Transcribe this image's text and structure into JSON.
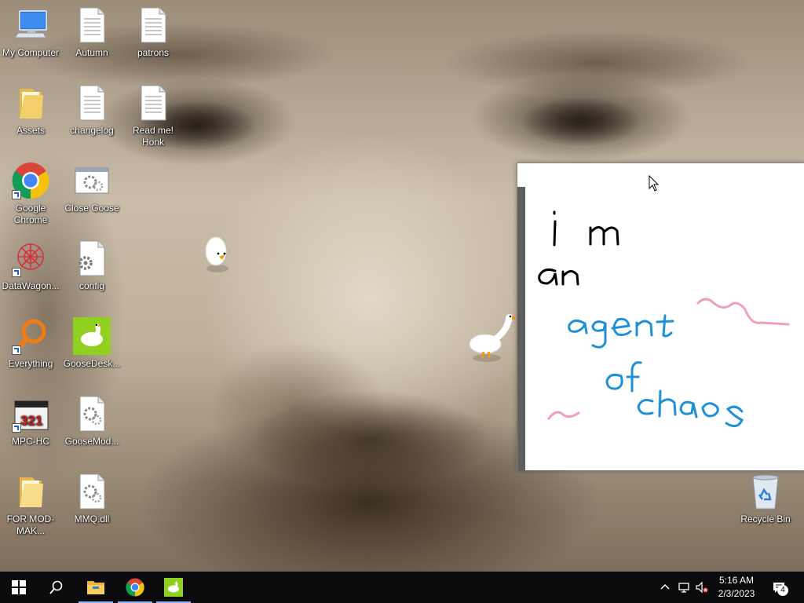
{
  "desktop": {
    "icons": [
      {
        "label": "My Computer",
        "icon": "computer-icon"
      },
      {
        "label": "Autumn",
        "icon": "text-file-icon"
      },
      {
        "label": "patrons",
        "icon": "text-file-icon"
      },
      {
        "label": "Assets",
        "icon": "folder-icon"
      },
      {
        "label": "changelog",
        "icon": "text-file-icon"
      },
      {
        "label": "Read me! Honk",
        "icon": "text-file-icon"
      },
      {
        "label": "Google Chrome",
        "icon": "chrome-icon"
      },
      {
        "label": "Close Goose",
        "icon": "batch-file-icon"
      },
      {
        "label": "DataWagon...",
        "icon": "datawagon-icon"
      },
      {
        "label": "config",
        "icon": "config-file-icon"
      },
      {
        "label": "Everything",
        "icon": "everything-search-icon"
      },
      {
        "label": "GooseDesk...",
        "icon": "goose-desktop-icon"
      },
      {
        "label": "MPC-HC",
        "icon": "mpc-hc-icon"
      },
      {
        "label": "GooseMod...",
        "icon": "batch-file-icon"
      },
      {
        "label": "FOR MOD-MAK...",
        "icon": "folder-icon"
      },
      {
        "label": "MMQ.dll",
        "icon": "dll-file-icon"
      },
      {
        "label": "Recycle Bin",
        "icon": "recycle-bin-icon"
      }
    ]
  },
  "note": {
    "lines": [
      "i m",
      "an",
      "agent",
      "of",
      "chaos"
    ],
    "ink_colors": {
      "black": "#000000",
      "blue": "#1e90d8",
      "pink": "#f0a0b4"
    }
  },
  "taskbar": {
    "start_icon": "windows-start-icon",
    "search_icon": "search-icon",
    "apps": [
      {
        "name": "File Explorer",
        "icon": "file-explorer-icon"
      },
      {
        "name": "Google Chrome",
        "icon": "chrome-icon"
      },
      {
        "name": "GooseDesktop",
        "icon": "goose-desktop-icon"
      }
    ],
    "tray": {
      "time": "5:16 AM",
      "date": "2/3/2023",
      "notification_count": "4"
    }
  },
  "colors": {
    "taskbar_bg": "#0b0b0d",
    "accent": "#8ab4f8"
  }
}
